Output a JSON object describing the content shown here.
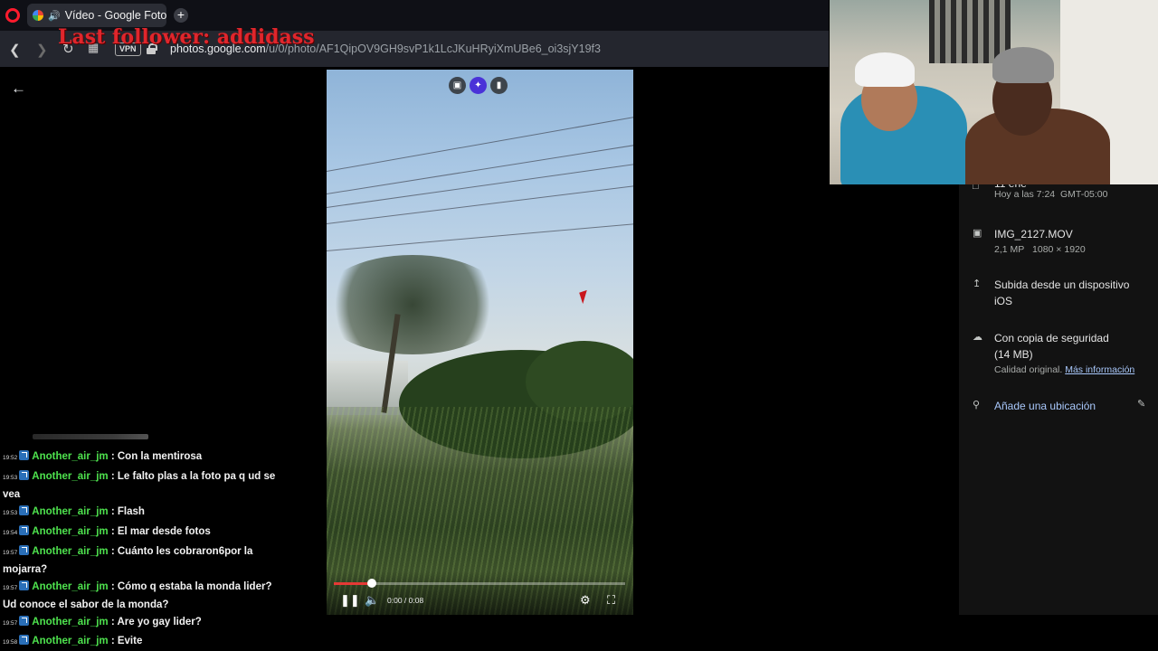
{
  "browser": {
    "tab_title": "Vídeo - Google Fotos",
    "new_tab_label": "+",
    "vpn_label": "VPN",
    "url_host": "photos.google.com",
    "url_path": "/u/0/photo/AF1QipOV9GH9svP1k1LcJKuHRyiXmUBe6_oi3sjY19f3"
  },
  "stream_overlay": {
    "last_follower": "Last follower: addidass"
  },
  "player": {
    "time": "0:00 / 0:08",
    "progress_fraction": 0.13,
    "buffered_fraction": 0.1
  },
  "info": {
    "date_partial": "11 ene",
    "date_time": "Hoy a las 7:24",
    "timezone": "GMT-05:00",
    "filename": "IMG_2127.MOV",
    "megapixels": "2,1 MP",
    "resolution": "1080 × 1920",
    "upload_line1": "Subida desde un dispositivo",
    "upload_line2": "iOS",
    "backup_line1": "Con copia de seguridad",
    "backup_line2": "(14 MB)",
    "quality": "Calidad original.",
    "more_info": "Más información",
    "add_location": "Añade una ubicación"
  },
  "chat": {
    "messages": [
      {
        "time": "19:52",
        "user": "Another_air_jm",
        "text": ": Con la mentirosa"
      },
      {
        "time": "19:53",
        "user": "Another_air_jm",
        "text": ": Le falto plas a la foto pa q ud se vea"
      },
      {
        "time": "19:53",
        "user": "Another_air_jm",
        "text": ": Flash"
      },
      {
        "time": "19:54",
        "user": "Another_air_jm",
        "text": ": El mar desde fotos"
      },
      {
        "time": "19:57",
        "user": "Another_air_jm",
        "text": ": Cuánto les cobraron6por la mojarra?"
      },
      {
        "time": "19:57",
        "user": "Another_air_jm",
        "text": ": Cómo q estaba la monda lider? Ud conoce el sabor de la monda?"
      },
      {
        "time": "19:57",
        "user": "Another_air_jm",
        "text": ": Are yo gay lider?"
      },
      {
        "time": "19:58",
        "user": "Another_air_jm",
        "text": ": Evite"
      }
    ]
  },
  "colors": {
    "chat_username": "#4ee24e",
    "overlay_text": "#e0262c",
    "progress": "#e53935",
    "link": "#a8c7fa"
  },
  "icons": {
    "mode_left": "motion-photo-icon",
    "mode_center": "enhance-icon",
    "mode_right": "video-camera-icon"
  }
}
